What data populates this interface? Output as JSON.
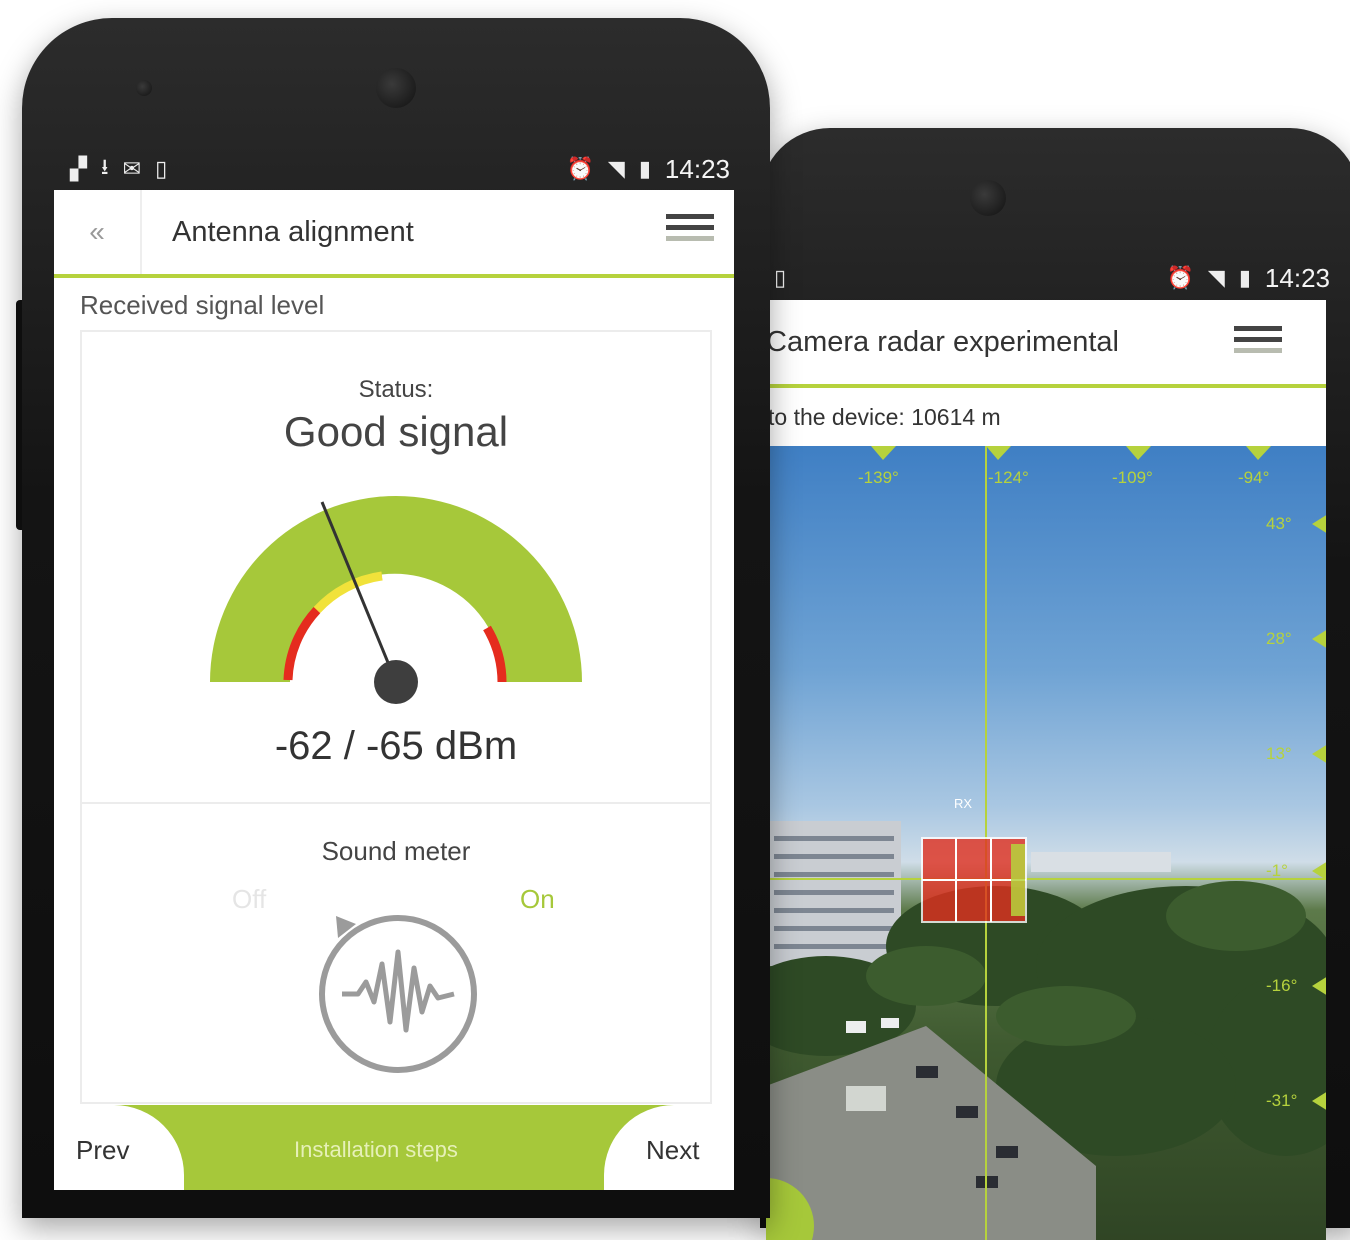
{
  "left_phone": {
    "status_time": "14:23",
    "appbar": {
      "back_label": "«",
      "title": "Antenna alignment"
    },
    "section_label": "Received signal level",
    "status_label": "Status:",
    "status_value": "Good signal",
    "gauge_reading": "-62 / -65 dBm",
    "sound_meter": {
      "title": "Sound meter",
      "off_label": "Off",
      "on_label": "On",
      "state": "On"
    },
    "bottom_nav": {
      "prev": "Prev",
      "middle": "Installation steps",
      "next": "Next"
    }
  },
  "right_phone": {
    "status_time": "14:23",
    "appbar": {
      "title": "Camera radar experimental"
    },
    "distance_text": "to the device: 10614 m",
    "horizontal_ticks": [
      "-139°",
      "-124°",
      "-109°",
      "-94°"
    ],
    "vertical_ticks": [
      "43°",
      "28°",
      "13°",
      "-1°",
      "-16°",
      "-31°"
    ],
    "target_label": "RX"
  },
  "colors": {
    "accent": "#a6c83a",
    "gauge_green": "#a6c83a",
    "gauge_yellow": "#f1e23a",
    "gauge_red": "#e52c1e",
    "text": "#333333"
  }
}
